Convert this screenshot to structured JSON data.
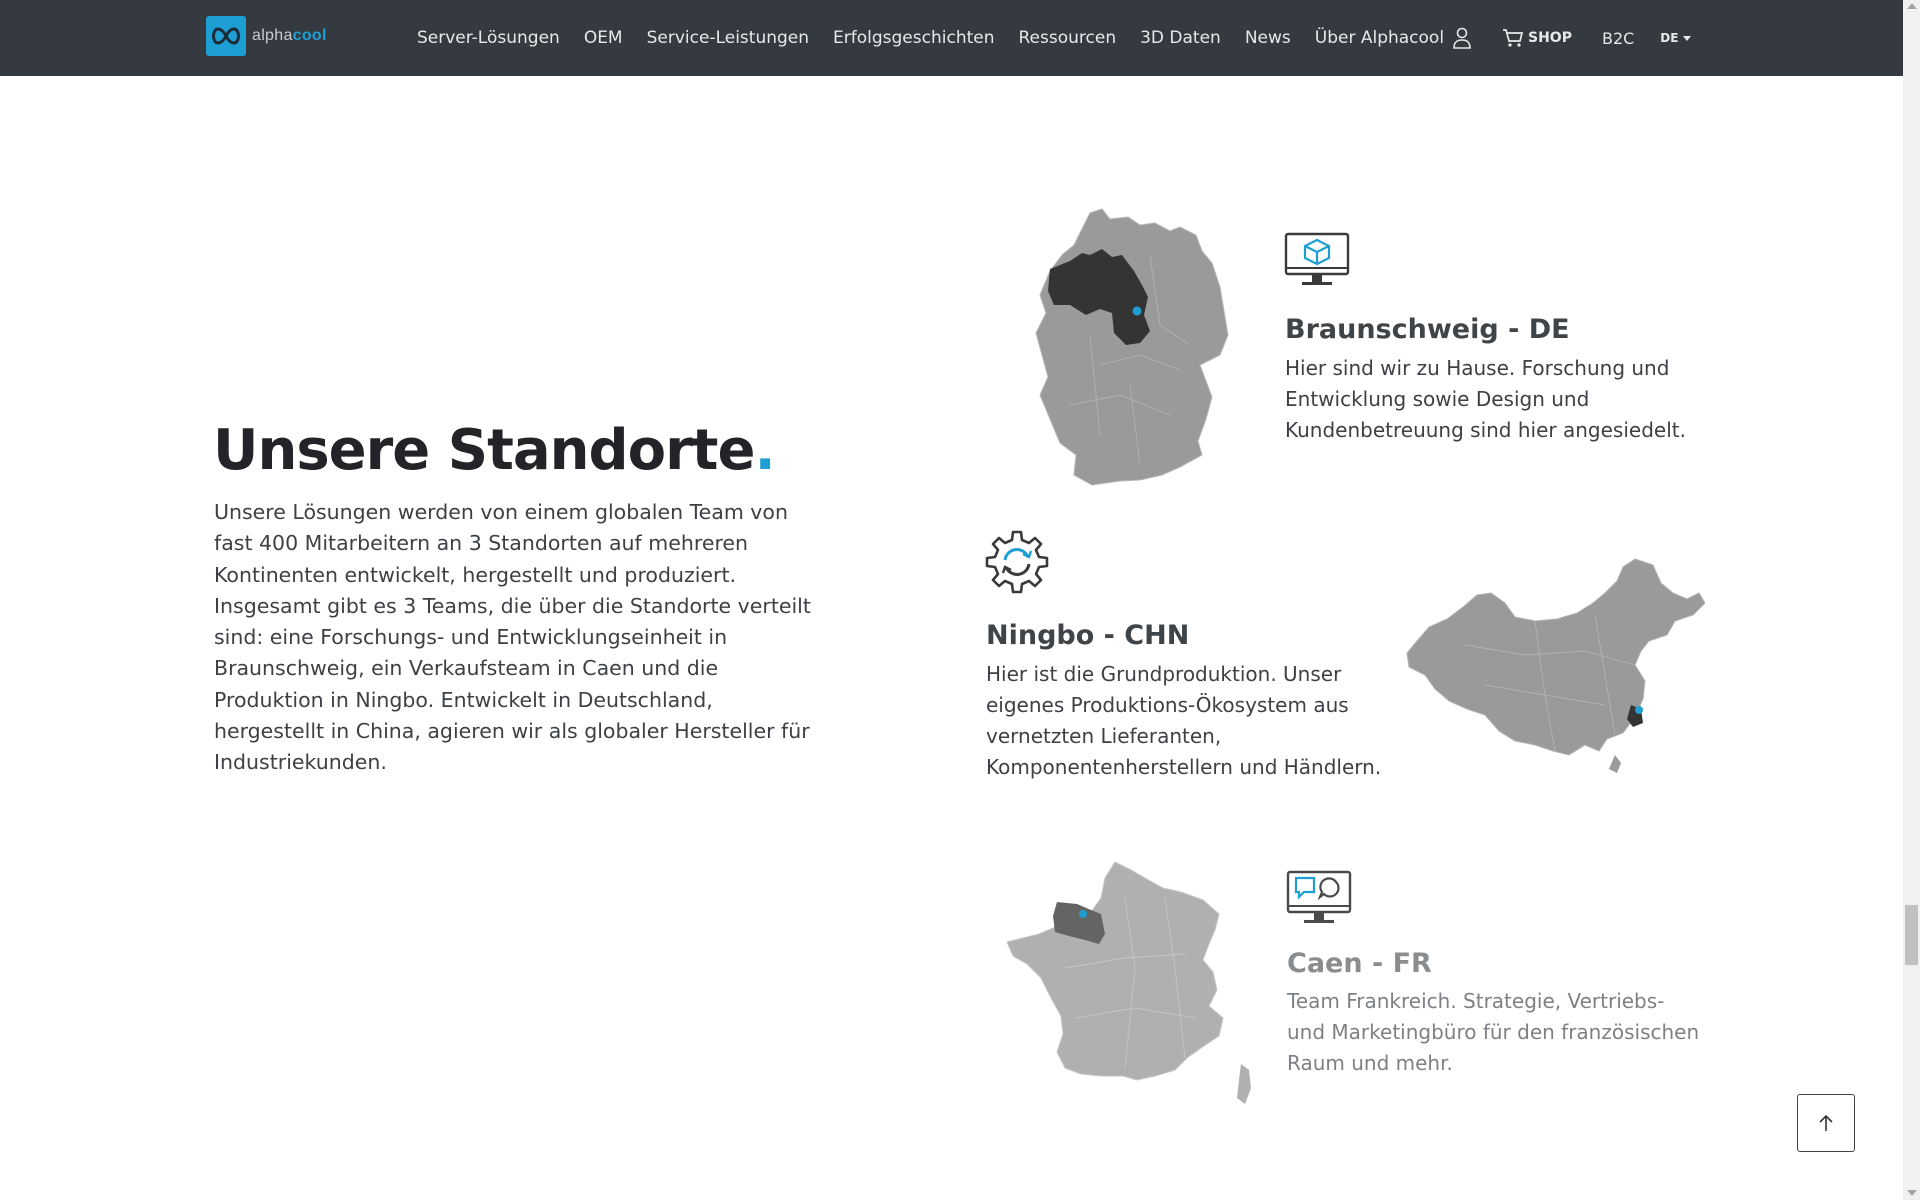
{
  "navbar": {
    "logo": {
      "text_light": "alpha",
      "text_brand": "cool"
    },
    "links": [
      "Server-Lösungen",
      "OEM",
      "Service-Leistungen",
      "Erfolgsgeschichten",
      "Ressourcen",
      "3D Daten",
      "News",
      "Über Alphacool"
    ],
    "shop_label": "SHOP",
    "b2c_label": "B2C",
    "lang_label": "DE"
  },
  "intro": {
    "title": "Unsere Standorte",
    "title_dot": ".",
    "text": "Unsere Lösungen werden von einem globalen Team von fast 400 Mitarbeitern an 3 Standorten auf mehreren Kontinenten entwickelt, hergestellt und produziert. Insgesamt gibt es 3 Teams, die über die Standorte verteilt sind: eine Forschungs- und Entwicklungseinheit in Braunschweig, ein Verkaufsteam in Caen und die Produktion in Ningbo. Entwickelt in Deutschland, hergestellt in China, agieren wir als globaler Hersteller für Industriekunden."
  },
  "locations": [
    {
      "title": "Braunschweig - DE",
      "text": "Hier sind wir zu Hause. Forschung und Entwicklung sowie Design und Kundenbetreuung sind hier angesiedelt.",
      "icon": "monitor-cube-icon",
      "map": "germany-map"
    },
    {
      "title": "Ningbo - CHN",
      "text": "Hier ist die Grundproduktion. Unser eigenes Produktions-Ökosystem aus vernetzten Lieferanten, Komponentenherstellern und Händlern.",
      "icon": "gear-refresh-icon",
      "map": "china-map"
    },
    {
      "title": "Caen - FR",
      "text": "Team Frankreich. Strategie, Vertriebs- und Marketingbüro für den französischen Raum und mehr.",
      "icon": "monitor-chat-icon",
      "map": "france-map"
    }
  ],
  "colors": {
    "nav_bg": "#343a40",
    "accent": "#1e9fd4",
    "map_gray": "#9a9a9a",
    "map_dark": "#333333"
  }
}
